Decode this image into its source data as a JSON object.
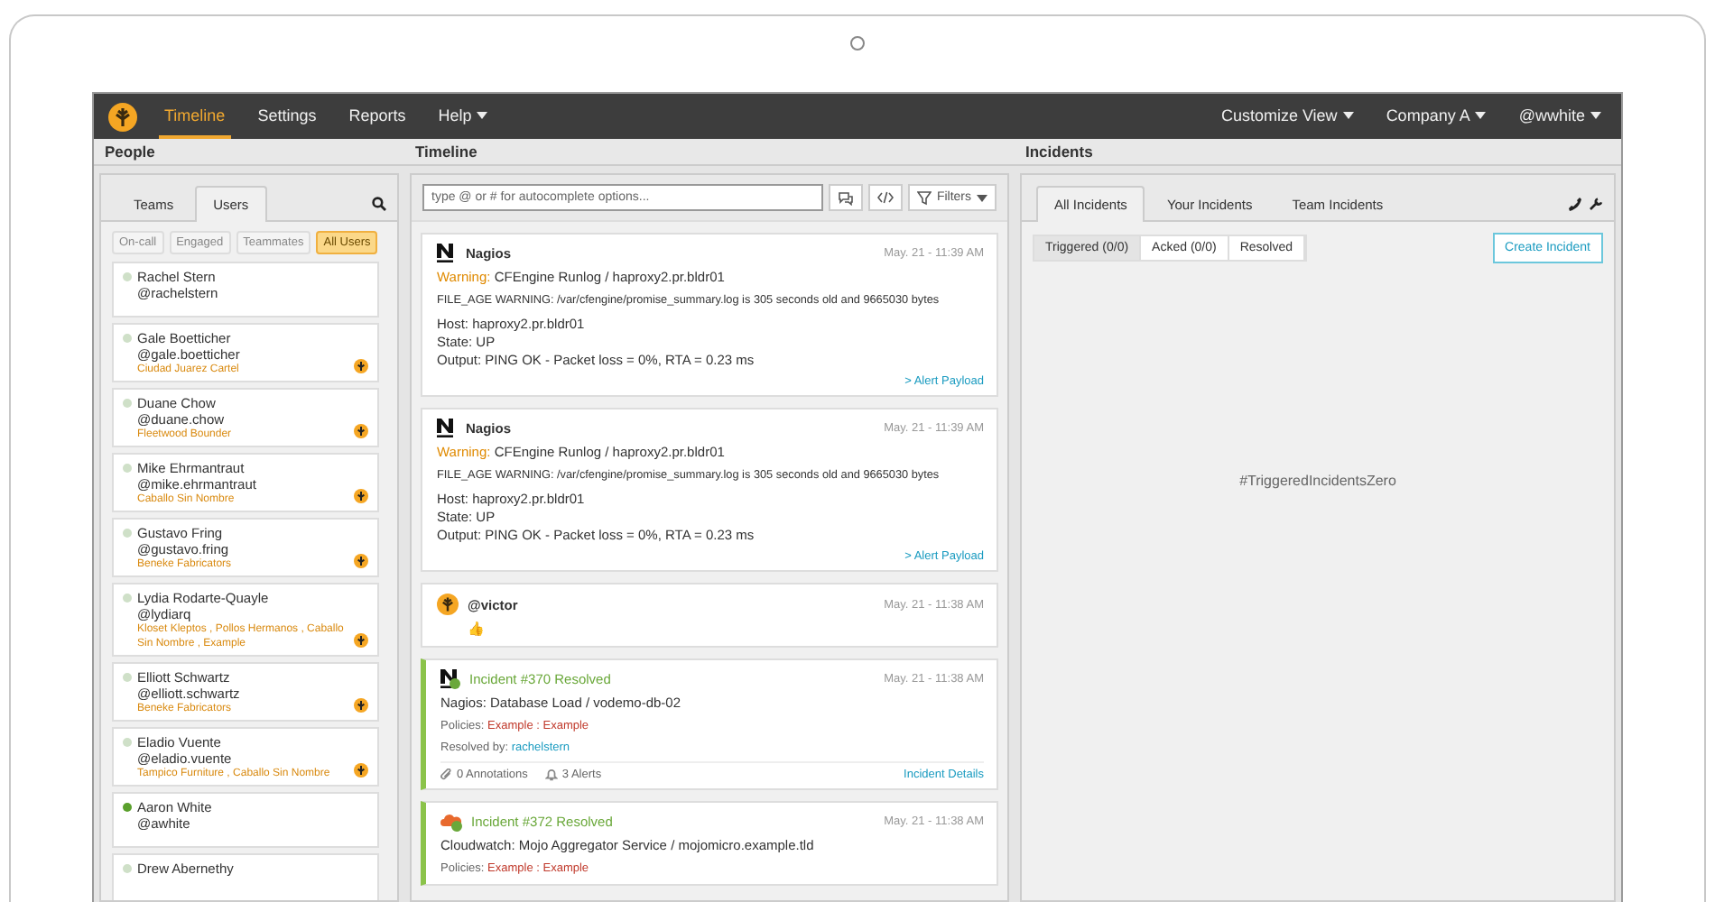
{
  "nav": {
    "items": [
      {
        "label": "Timeline",
        "selected": true
      },
      {
        "label": "Settings",
        "selected": false
      },
      {
        "label": "Reports",
        "selected": false
      },
      {
        "label": "Help",
        "selected": false,
        "menu": true
      }
    ],
    "right": [
      {
        "label": "Customize View"
      },
      {
        "label": "Company A"
      },
      {
        "label": "@wwhite"
      }
    ]
  },
  "headers": [
    "People",
    "Timeline",
    "Incidents"
  ],
  "people": {
    "tabs": [
      {
        "label": "Teams",
        "selected": false
      },
      {
        "label": "Users",
        "selected": true
      }
    ],
    "filters": [
      {
        "label": "On-call",
        "selected": false
      },
      {
        "label": "Engaged",
        "selected": false
      },
      {
        "label": "Teammates",
        "selected": false
      },
      {
        "label": "All Users",
        "selected": true
      }
    ],
    "users": [
      {
        "name": "Rachel Stern",
        "handle": "@rachelstern",
        "online": false,
        "on_call": false
      },
      {
        "name": "Gale Boetticher",
        "handle": "@gale.boetticher",
        "teams": "Ciudad Juarez Cartel",
        "online": false,
        "on_call": true
      },
      {
        "name": "Duane Chow",
        "handle": "@duane.chow",
        "teams": "Fleetwood Bounder",
        "online": false,
        "on_call": true
      },
      {
        "name": "Mike Ehrmantraut",
        "handle": "@mike.ehrmantraut",
        "teams": "Caballo Sin Nombre",
        "online": false,
        "on_call": true
      },
      {
        "name": "Gustavo Fring",
        "handle": "@gustavo.fring",
        "teams": "Beneke Fabricators",
        "online": false,
        "on_call": true
      },
      {
        "name": "Lydia Rodarte-Quayle",
        "handle": "@lydiarq",
        "teams": "Kloset Kleptos , Pollos Hermanos , Caballo Sin Nombre , Example",
        "online": false,
        "on_call": true
      },
      {
        "name": "Elliott Schwartz",
        "handle": "@elliott.schwartz",
        "teams": "Beneke Fabricators",
        "online": false,
        "on_call": true
      },
      {
        "name": "Eladio Vuente",
        "handle": "@eladio.vuente",
        "teams": "Tampico Furniture , Caballo Sin Nombre",
        "online": false,
        "on_call": true
      },
      {
        "name": "Aaron White",
        "handle": "@awhite",
        "online": true,
        "on_call": false
      },
      {
        "name": "Drew Abernethy",
        "online": false,
        "on_call": false
      }
    ]
  },
  "timeline": {
    "placeholder": "type @ or # for autocomplete options...",
    "filters_label": "Filters",
    "entries": [
      {
        "kind": "alert",
        "source": "Nagios",
        "time": "May. 21 - 11:39 AM",
        "level": "Warning:",
        "title": "CFEngine Runlog / haproxy2.pr.bldr01",
        "message": "FILE_AGE WARNING: /var/cfengine/promise_summary.log is 305 seconds old and 9665030 bytes",
        "details": [
          "Host: haproxy2.pr.bldr01",
          "State: UP",
          "Output: PING OK - Packet loss = 0%, RTA = 0.23 ms"
        ],
        "link": "> Alert Payload"
      },
      {
        "kind": "alert",
        "source": "Nagios",
        "time": "May. 21 - 11:39 AM",
        "level": "Warning:",
        "title": "CFEngine Runlog / haproxy2.pr.bldr01",
        "message": "FILE_AGE WARNING: /var/cfengine/promise_summary.log is 305 seconds old and 9665030 bytes",
        "details": [
          "Host: haproxy2.pr.bldr01",
          "State: UP",
          "Output: PING OK - Packet loss = 0%, RTA = 0.23 ms"
        ],
        "link": "> Alert Payload"
      },
      {
        "kind": "chat",
        "source": "@victor",
        "time": "May. 21 - 11:38 AM",
        "message": "👍"
      },
      {
        "kind": "incident",
        "source": "Incident #370 Resolved",
        "time": "May. 21 - 11:38 AM",
        "title": "Nagios: Database Load / vodemo-db-02",
        "policies_label": "Policies:",
        "policies": "Example : Example",
        "resolved_label": "Resolved by:",
        "resolved_by": "rachelstern",
        "annotations": "0 Annotations",
        "alerts": "3 Alerts",
        "link": "Incident Details"
      },
      {
        "kind": "incident",
        "source": "Incident #372 Resolved",
        "time": "May. 21 - 11:38 AM",
        "title": "Cloudwatch: Mojo Aggregator Service / mojomicro.example.tld",
        "policies_label": "Policies:",
        "policies": "Example : Example"
      }
    ]
  },
  "incidents": {
    "tabs": [
      {
        "label": "All Incidents",
        "selected": true
      },
      {
        "label": "Your Incidents",
        "selected": false
      },
      {
        "label": "Team Incidents",
        "selected": false
      }
    ],
    "states": [
      {
        "label": "Triggered (0/0)",
        "selected": true
      },
      {
        "label": "Acked (0/0)",
        "selected": false
      },
      {
        "label": "Resolved",
        "selected": false
      }
    ],
    "create": "Create Incident",
    "empty": "#TriggeredIncidentsZero"
  }
}
